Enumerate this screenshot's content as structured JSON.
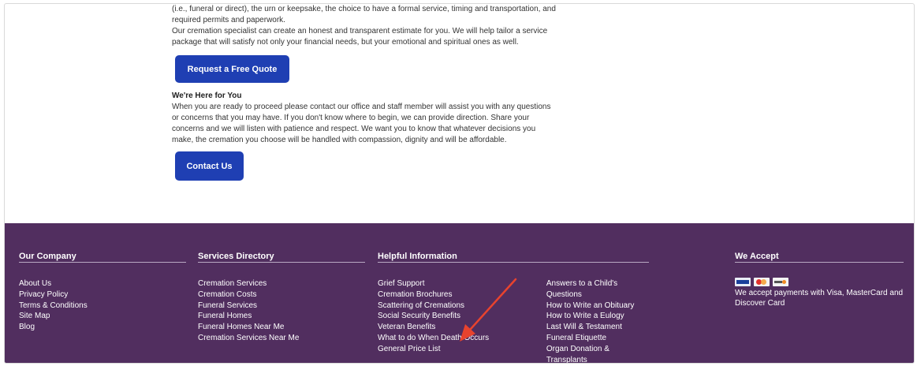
{
  "content": {
    "paragraph1_lines": [
      "(i.e., funeral or direct), the urn or keepsake, the choice to have a formal service, timing and transportation, and",
      "required permits and paperwork."
    ],
    "paragraph2_lines": [
      "Our cremation specialist can create an honest and transparent estimate for you. We will help tailor a service",
      "package that will satisfy not only your financial needs, but your emotional and spiritual ones as well."
    ],
    "quote_button": "Request a Free Quote",
    "here_heading": "We're Here for You",
    "paragraph3_lines": [
      "When you are ready to proceed please contact our office and staff member will assist you with any questions",
      "or concerns that you may have. If you don't know where to begin, we can provide direction. Share your",
      "concerns and we will listen with patience and respect. We want you to know that whatever decisions you",
      "make, the cremation you choose will be handled with compassion, dignity and will be affordable."
    ],
    "contact_button": "Contact Us"
  },
  "footer": {
    "company": {
      "title": "Our Company",
      "links": [
        "About Us",
        "Privacy Policy",
        "Terms & Conditions",
        "Site Map",
        "Blog"
      ]
    },
    "services": {
      "title": "Services Directory",
      "links": [
        "Cremation Services",
        "Cremation Costs",
        "Funeral Services",
        "Funeral Homes",
        "Funeral Homes Near Me",
        "Cremation Services Near Me"
      ]
    },
    "helpful": {
      "title": "Helpful Information",
      "links_col1": [
        "Grief Support",
        "Cremation Brochures",
        "Scattering of Cremations",
        "Social Security Benefits",
        "Veteran Benefits",
        "What to do When Death Occurs",
        "General Price List"
      ],
      "links_col2": [
        "Answers to a Child's Questions",
        "How to Write an Obituary",
        "How to Write a Eulogy",
        "Last Will & Testament",
        "Funeral Etiquette",
        "Organ Donation & Transplants"
      ]
    },
    "accept": {
      "title": "We Accept",
      "card_icons": [
        "visa-card-icon",
        "mastercard-icon",
        "discover-card-icon"
      ],
      "text_lines": [
        "We accept payments with Visa, MasterCard and",
        "Discover Card"
      ]
    }
  },
  "colors": {
    "button_blue": "#1f3fb3",
    "footer_purple": "#512e5f",
    "annotation_arrow": "#e8432e"
  }
}
